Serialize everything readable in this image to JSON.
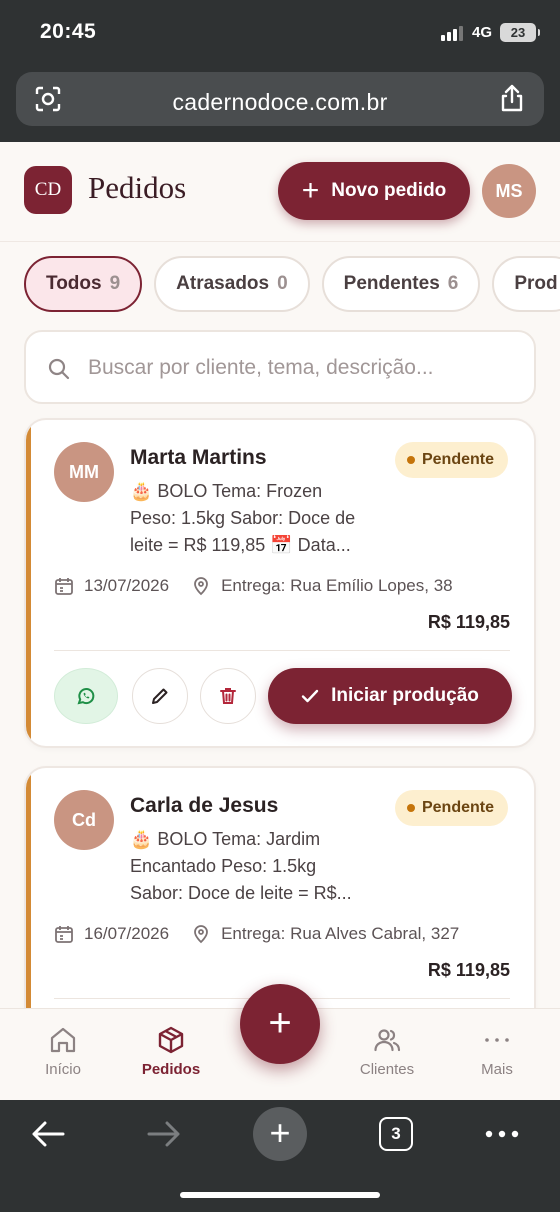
{
  "status": {
    "time": "20:45",
    "network": "4G",
    "battery": "23"
  },
  "browser": {
    "url": "cadernodoce.com.br",
    "tabs_count": "3"
  },
  "header": {
    "logo": "CD",
    "title": "Pedidos",
    "new_order_label": "Novo pedido",
    "user_initials": "MS"
  },
  "filters": [
    {
      "label": "Todos",
      "count": "9",
      "active": true
    },
    {
      "label": "Atrasados",
      "count": "0"
    },
    {
      "label": "Pendentes",
      "count": "6"
    },
    {
      "label": "Prod",
      "count": ""
    }
  ],
  "search": {
    "placeholder": "Buscar por cliente, tema, descrição..."
  },
  "orders": [
    {
      "initials": "MM",
      "name": "Marta Martins",
      "status": "Pendente",
      "desc_line1": "🎂 BOLO Tema: Frozen",
      "desc_line2": "Peso: 1.5kg Sabor: Doce de",
      "desc_line3": "leite = R$ 119,85 📅 Data...",
      "date": "13/07/2026",
      "delivery": "Entrega: Rua Emílio Lopes, 38",
      "price": "R$ 119,85",
      "action_label": "Iniciar produção"
    },
    {
      "initials": "Cd",
      "name": "Carla de Jesus",
      "status": "Pendente",
      "desc_line1": "🎂 BOLO Tema: Jardim",
      "desc_line2": "Encantado  Peso: 1.5kg",
      "desc_line3": "Sabor: Doce de leite = R$...",
      "date": "16/07/2026",
      "delivery": "Entrega: Rua Alves Cabral, 327",
      "price": "R$ 119,85"
    }
  ],
  "nav": [
    {
      "label": "Início",
      "icon": "home-icon"
    },
    {
      "label": "Pedidos",
      "icon": "box-icon",
      "active": true
    },
    {
      "label": "Clientes",
      "icon": "users-icon"
    },
    {
      "label": "Mais",
      "icon": "more-icon"
    }
  ],
  "colors": {
    "brand": "#7c2333",
    "accent_bar": "#d38a35",
    "badge_bg": "#fdefcf"
  }
}
